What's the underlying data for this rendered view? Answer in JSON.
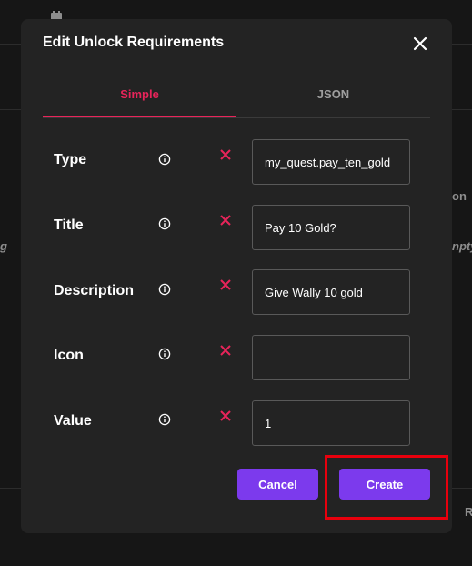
{
  "background": {
    "right_text_1": "on",
    "right_text_2": "npty",
    "left_text_1": "g",
    "bottom_right_text": "R"
  },
  "modal": {
    "title": "Edit Unlock Requirements",
    "tabs": [
      {
        "label": "Simple",
        "active": true
      },
      {
        "label": "JSON",
        "active": false
      }
    ],
    "fields": [
      {
        "label": "Type",
        "value": "my_quest.pay_ten_gold"
      },
      {
        "label": "Title",
        "value": "Pay 10 Gold?"
      },
      {
        "label": "Description",
        "value": "Give Wally 10 gold"
      },
      {
        "label": "Icon",
        "value": ""
      },
      {
        "label": "Value",
        "value": "1"
      }
    ],
    "cancel_label": "Cancel",
    "create_label": "Create"
  },
  "colors": {
    "accent": "#e8245a",
    "button": "#7c3aed",
    "highlight": "#e8000d",
    "modal_bg": "#232323"
  },
  "icons": {
    "close": "close-icon",
    "info": "info-icon",
    "remove": "remove-x-icon",
    "calendar": "calendar-icon"
  }
}
